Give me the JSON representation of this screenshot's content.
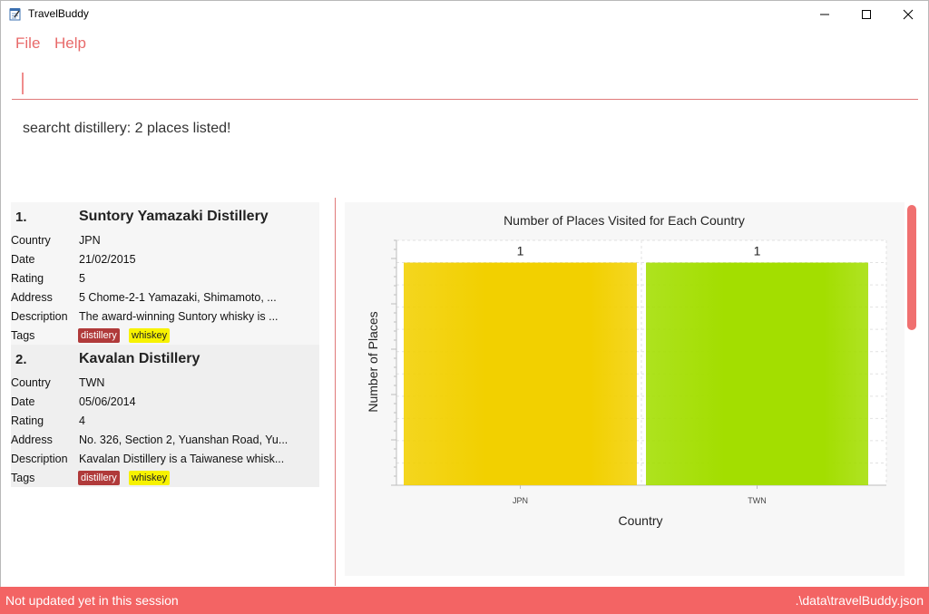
{
  "window": {
    "title": "TravelBuddy",
    "icon": "notepad-icon",
    "controls": {
      "minimize": "–",
      "maximize": "☐",
      "close": "✕"
    }
  },
  "menu": {
    "file": "File",
    "help": "Help"
  },
  "command": {
    "value": ""
  },
  "result": {
    "text": "searcht distillery: 2 places listed!"
  },
  "labels": {
    "country": "Country",
    "date": "Date",
    "rating": "Rating",
    "address": "Address",
    "description": "Description",
    "tags": "Tags"
  },
  "places": [
    {
      "index": "1.",
      "name": "Suntory Yamazaki Distillery",
      "country": "JPN",
      "date": "21/02/2015",
      "rating": "5",
      "address": "5 Chome-2-1 Yamazaki, Shimamoto, ...",
      "description": "The award-winning Suntory whisky is ...",
      "tags": [
        "distillery",
        "whiskey"
      ]
    },
    {
      "index": "2.",
      "name": "Kavalan Distillery",
      "country": "TWN",
      "date": "05/06/2014",
      "rating": "4",
      "address": "No. 326, Section 2, Yuanshan Road, Yu...",
      "description": "Kavalan Distillery is a Taiwanese whisk...",
      "tags": [
        "distillery",
        "whiskey"
      ]
    }
  ],
  "colors": {
    "accent": "#f36464",
    "tag_red": "#b03a3a",
    "tag_yellow": "#f7f200",
    "bar_jpn": "#f2d000",
    "bar_twn": "#a3de00"
  },
  "chart_data": {
    "type": "bar",
    "title": "Number of Places Visited for Each Country",
    "xlabel": "Country",
    "ylabel": "Number of Places",
    "categories": [
      "JPN",
      "TWN"
    ],
    "values": [
      1,
      1
    ],
    "data_labels": [
      "1",
      "1"
    ],
    "ylim": [
      0,
      1.1
    ],
    "grid": true,
    "legend": false
  },
  "status": {
    "left": "Not updated yet in this session",
    "right": ".\\data\\travelBuddy.json"
  }
}
